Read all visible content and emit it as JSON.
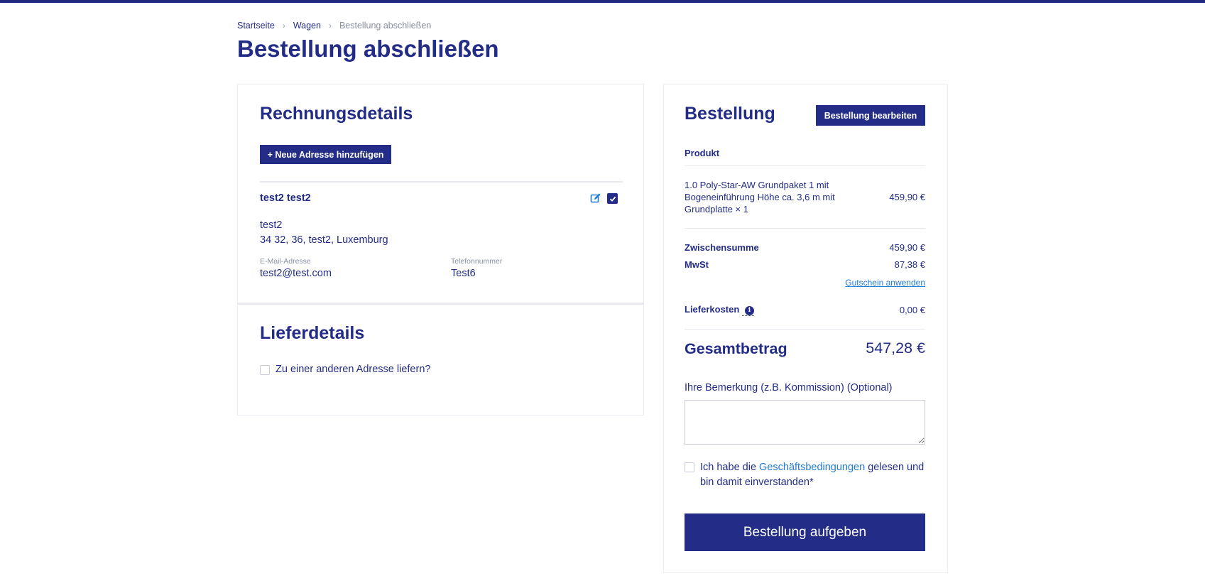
{
  "breadcrumb": {
    "items": [
      "Startseite",
      "Wagen"
    ],
    "current": "Bestellung abschließen"
  },
  "page_title": "Bestellung abschließen",
  "billing": {
    "title": "Rechnungsdetails",
    "add_address_label": "+ Neue Adresse hinzufügen",
    "address": {
      "name": "test2 test2",
      "company": "test2",
      "street": "34 32, 36, test2, Luxemburg",
      "email_label": "E-Mail-Adresse",
      "email": "test2@test.com",
      "phone_label": "Telefonnummer",
      "phone": "Test6",
      "selected": true
    }
  },
  "delivery": {
    "title": "Lieferdetails",
    "other_address_label": "Zu einer anderen Adresse liefern?"
  },
  "order": {
    "title": "Bestellung",
    "edit_label": "Bestellung bearbeiten",
    "product_header": "Produkt",
    "items": [
      {
        "line1": "1.0 Poly-Star-AW Grundpaket 1 mit",
        "line2": "Bogeneinführung Höhe ca. 3,6 m mit",
        "line3": "Grundplatte × 1",
        "price": "459,90 €"
      }
    ],
    "subtotal_label": "Zwischensumme",
    "subtotal": "459,90 €",
    "vat_label": "MwSt",
    "vat": "87,38 €",
    "coupon_label": "Gutschein anwenden",
    "shipping_label": "Lieferkosten",
    "shipping": "0,00 €",
    "total_label": "Gesamtbetrag",
    "total": "547,28 €",
    "note_label": "Ihre Bemerkung (z.B. Kommission) (Optional)",
    "terms_prefix": "Ich habe die ",
    "terms_link": "Geschäftsbedingungen",
    "terms_suffix": " gelesen und bin damit einverstanden*",
    "submit_label": "Bestellung aufgeben"
  },
  "colors": {
    "primary": "#232c86",
    "link": "#1f7ad6",
    "border": "#ebedf2"
  }
}
